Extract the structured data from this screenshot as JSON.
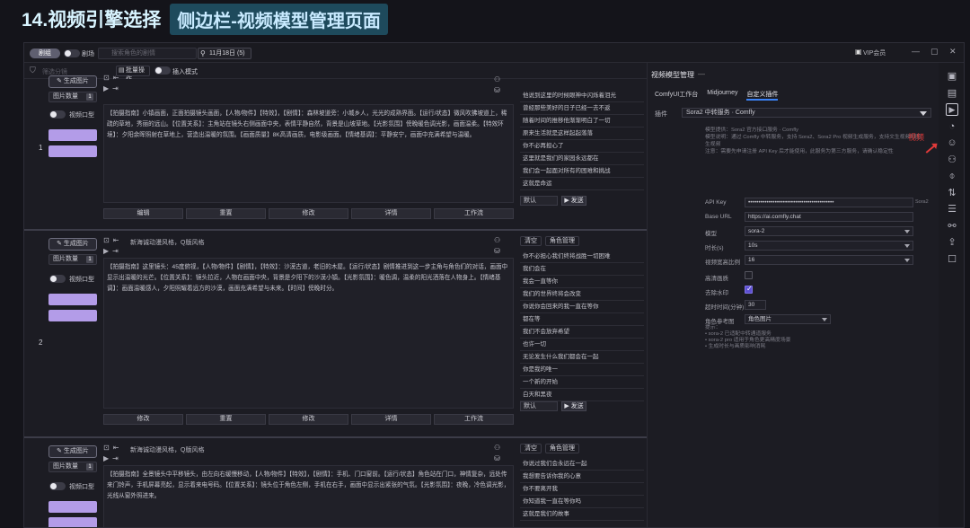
{
  "heading": {
    "title": "14.视频引擎选择",
    "subtitle": "侧边栏-视频模型管理页面"
  },
  "topbar": {
    "mode_label": "剧组",
    "toggle_label": "剧场",
    "search_placeholder": "搜索角色的剧情",
    "date_label": "11月18日 (5)",
    "vip_label": "VIP会员",
    "win_min": "—",
    "win_max": "▢",
    "win_close": "✕"
  },
  "subbar": {
    "filter_placeholder": "筛选分镜",
    "batch_button": "批量操作",
    "toggle_label": "插入模式"
  },
  "shots": [
    {
      "index": "1",
      "gen_button": "生成图片",
      "select_label": "图片数量",
      "select_count": "1",
      "toggle_label": "视频口型",
      "purple1": "",
      "purple2": "",
      "caption": "",
      "text": "【拍摄指南】小镇画面，正面拍摄镜头画面，【人物/物件】【特效】，【剧情】：森林坡道旁：小城乡人，光光的成熟界面。【运行/状态】微风吹拂坡道上，稀疏的草地，秀丽的远山。【位置关系】：主角站在镜头右侧画面中央，表情平静自然，背景是山坡草地。【光影氛围】傍晚暖色调光影，画面温柔。【特效环境】：夕阳余晖照射在草地上，营造出温暖的氛围。【画面质量】8K高清画质，电影级画面。【情绪基调】：平静安宁，画面中充满希望与温暖。",
      "bottoms": [
        "编辑",
        "重置",
        "修改",
        "详情",
        "工作流"
      ],
      "list": [
        "他说到这里的时候眼神中闪烁着泪光",
        "曾经那些美好的日子已经一去不返",
        "随着时间的推移他渐渐明白了一切",
        "原来生活就是这样起起落落",
        "你不必再担心了",
        "这里就是我们的家园永远都在",
        "我们会一起面对所有的困难和挑战",
        "这就是命运"
      ],
      "send_dd": "默认",
      "send_btn": "发送"
    },
    {
      "index": "2",
      "gen_button": "生成图片",
      "select_label": "图片数量",
      "select_count": "1",
      "toggle_label": "视频口型",
      "purple1": "",
      "purple2": "",
      "caption": "新海诚动漫风格，Q版风格",
      "text": "【拍摄指南】这里镜头：45度俯视，【人物/物件】【剧情】，【特效】：沙漠古道，老旧的木屋。【运行/状态】剧情推进到这一步主角与角色们的对话，画面中显示出温暖的光芒。【位置关系】：镜头拉近，人物在画面中央，背景是夕阳下的沙漠小镇。【光影氛围】：暖色调，温柔的阳光洒落在人物身上。【情绪基调】：画面温暖感人，夕阳照耀着远方的沙漠，画面充满希望与未来。【时间】傍晚时分。",
      "bottoms": [
        "修改",
        "重置",
        "修改",
        "详情",
        "工作流"
      ],
      "list": [
        "你不必担心我们终将战胜一切困难",
        "我们会在",
        "我会一直等你",
        "我们的世界终将会改变",
        "你说你会回来的我一直在等你",
        "都在等",
        "我们不会放弃希望",
        "也许一切",
        "无论发生什么我们都会在一起",
        "你是我的唯一",
        "一个新的开始",
        "白天和黑夜"
      ],
      "send_dd": "默认",
      "send_btn": "发送"
    },
    {
      "index": "3",
      "gen_button": "生成图片",
      "select_label": "图片数量",
      "select_count": "1",
      "toggle_label": "视频口型",
      "purple1": "",
      "purple2": "",
      "caption": "新海诚动漫风格，Q版风格",
      "text": "【拍摄指南】全景镜头中平移镜头，由左向右缓慢移动，【人物/物件】【特效】，【剧情】：手机、门口窗前。【运行/状态】角色站在门口，神情复杂，远处传来门铃声，手机屏幕亮起，显示着来电号码。【位置关系】：镜头位于角色左侧，手机在右手，画面中显示出紧张的气氛。【光影氛围】：夜晚，冷色调光影，光线从窗外照进来。",
      "bottoms": [],
      "list": [
        "你说过我们会永远在一起",
        "我想要告诉你我的心意",
        "你不要离开我",
        "你知道我一直在等你吗",
        "这就是我们的故事"
      ],
      "send_dd": "",
      "send_btn": ""
    }
  ],
  "shot_tools": {
    "list_btn1": "清空",
    "list_btn2": "角色管理"
  },
  "panel": {
    "title": "视频模型管理",
    "title_extra": "—",
    "tabs": [
      "ComfyUI工作台",
      "Midjourney",
      "自定义插件"
    ],
    "active_tab": 2,
    "plugin_label": "插件",
    "plugin_value": "Sora2 中转服务 · Comfly",
    "notes": [
      "模型提供：Sora2 官方接口服务 · Comfly",
      "模型说明：通过 Comfly 中转服务，支持 Sora2、Sora2 Pro 视频生成服务，支持文生视频和图生视频",
      "注意：需要先申请注册 API Key 后才能使用，此服务为第三方服务，请确认稳定性"
    ],
    "video_tag": "视频",
    "fields": [
      {
        "label": "API Key",
        "value": "••••••••••••••••••••••••••••••••••••••••••",
        "kind": "input",
        "suffix": "Sora2"
      },
      {
        "label": "Base URL",
        "value": "https://ai.comfly.chat",
        "kind": "input",
        "suffix": ""
      },
      {
        "label": "模型",
        "value": "sora-2",
        "kind": "dropdown",
        "suffix": ""
      },
      {
        "label": "时长(s)",
        "value": "10s",
        "kind": "dropdown",
        "suffix": ""
      },
      {
        "label": "视频宽高比例",
        "value": "16",
        "kind": "dropdown",
        "suffix": ""
      },
      {
        "label": "高清画质",
        "value": "",
        "kind": "checkbox-off",
        "suffix": ""
      },
      {
        "label": "去除水印",
        "value": "",
        "kind": "checkbox-on",
        "suffix": ""
      },
      {
        "label": "超时时间(分钟)",
        "value": "30",
        "kind": "mini",
        "suffix": ""
      },
      {
        "label": "角色参考图",
        "value": "角色图片",
        "kind": "dropdown-short",
        "suffix": ""
      }
    ],
    "tips": [
      "提示：",
      "• sora-2 已适配中转通道服务",
      "• sora-2 pro 适用于角色更高精度场景",
      "• 生成时长与画质影响消耗"
    ]
  },
  "sidebar_icons": [
    "image-icon",
    "gallery-icon",
    "video-model-icon",
    "character-icon",
    "person-icon",
    "storyboard-icon",
    "mic-icon",
    "sort-icon",
    "settings-icon",
    "workflow-icon",
    "export-icon",
    "chat-icon"
  ],
  "sidebar_glyphs": [
    "▣",
    "▤",
    "▶",
    "◔",
    "☺",
    "⚇",
    "⌽",
    "⇅",
    "☰",
    "⚯",
    "⇪",
    "☐"
  ],
  "highlight_icon_index": 2,
  "colors": {
    "accent_purple": "#b39ce8",
    "tab_underline": "#3b82f6",
    "annotation_red": "#e03a3a",
    "heading_bg": "#1e4a5c"
  }
}
